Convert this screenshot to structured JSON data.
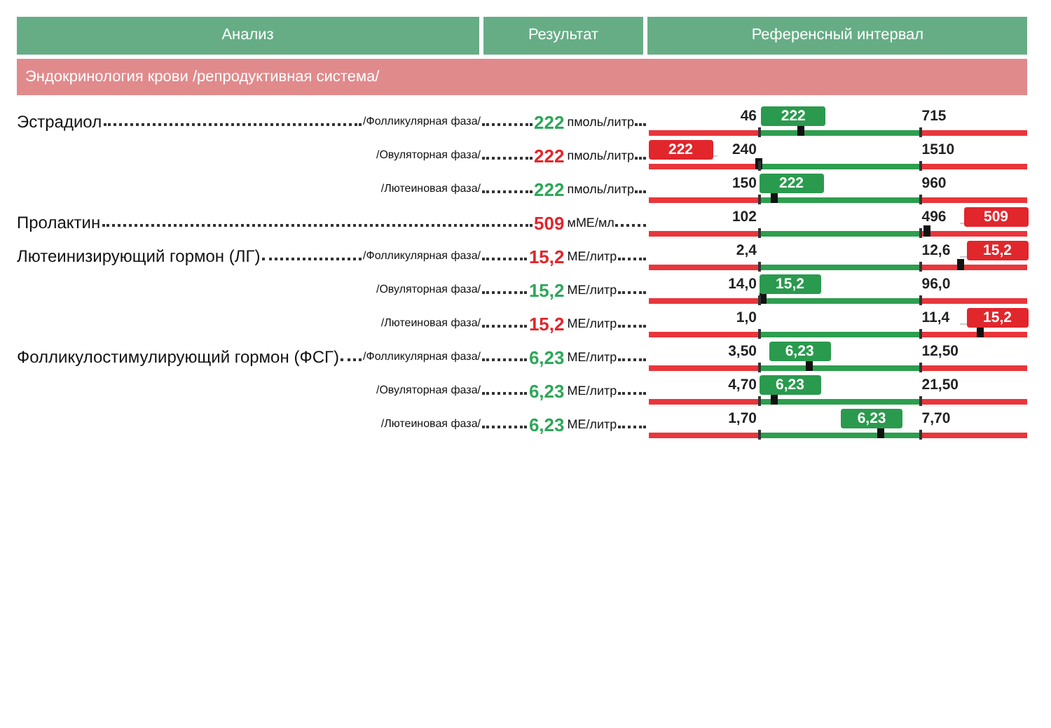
{
  "table": {
    "columns": [
      "Анализ",
      "Результат",
      "Референсный интервал"
    ],
    "section": "Эндокринология крови /репродуктивная система/",
    "rows": [
      {
        "name": "Эстрадиол",
        "phase": "/Фолликулярная фаза/",
        "result": "222",
        "unit": "пмоль/литр",
        "kind": "normal",
        "low": "46",
        "high": "715",
        "badge": "222",
        "level": 0.4
      },
      {
        "phase": "/Овуляторная фаза/",
        "result": "222",
        "unit": "пмоль/литр",
        "kind": "low",
        "low": "240",
        "high": "1510",
        "badge": "222",
        "level": 0.29
      },
      {
        "phase": "/Лютеиновая фаза/",
        "result": "222",
        "unit": "пмоль/литр",
        "kind": "normal",
        "low": "150",
        "high": "960",
        "badge": "222",
        "level": 0.33
      },
      {
        "name": "Пролактин",
        "result": "509",
        "unit": "мМЕ/мл",
        "kind": "high",
        "low": "102",
        "high": "496",
        "badge": "509",
        "level": 0.73
      },
      {
        "name": "Лютеинизирующий гормон (ЛГ)",
        "phase": "/Фолликулярная фаза/",
        "result": "15,2",
        "unit": "МЕ/литр",
        "kind": "high",
        "low": "2,4",
        "high": "12,6",
        "badge": "15,2",
        "level": 0.82
      },
      {
        "phase": "/Овуляторная фаза/",
        "result": "15,2",
        "unit": "МЕ/литр",
        "kind": "normal",
        "low": "14,0",
        "high": "96,0",
        "badge": "15,2",
        "level": 0.3
      },
      {
        "phase": "/Лютеиновая фаза/",
        "result": "15,2",
        "unit": "МЕ/литр",
        "kind": "high",
        "low": "1,0",
        "high": "11,4",
        "badge": "15,2",
        "level": 0.87
      },
      {
        "name": "Фолликулостимулирующий гормон (ФСГ)",
        "phase": "/Фолликулярная фаза/",
        "result": "6,23",
        "unit": "МЕ/литр",
        "kind": "normal",
        "low": "3,50",
        "high": "12,50",
        "badge": "6,23",
        "level": 0.42
      },
      {
        "phase": "/Овуляторная фаза/",
        "result": "6,23",
        "unit": "МЕ/литр",
        "kind": "normal",
        "low": "4,70",
        "high": "21,50",
        "badge": "6,23",
        "level": 0.33
      },
      {
        "phase": "/Лютеиновая фаза/",
        "result": "6,23",
        "unit": "МЕ/литр",
        "kind": "normal",
        "low": "1,70",
        "high": "7,70",
        "badge": "6,23",
        "level": 0.61
      }
    ]
  }
}
